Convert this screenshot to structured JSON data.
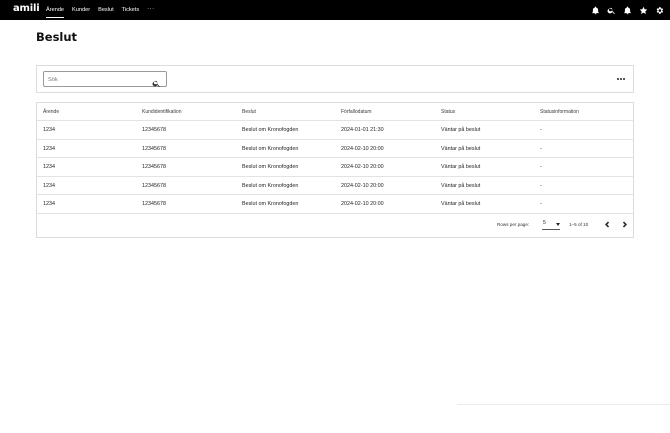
{
  "app": {
    "logo": "amili"
  },
  "nav": {
    "items": [
      {
        "label": "Ärende"
      },
      {
        "label": "Kunder"
      },
      {
        "label": "Beslut"
      },
      {
        "label": "Tickets"
      }
    ],
    "more_label": "···"
  },
  "top_icons": [
    "bell-icon",
    "search-icon",
    "notification-icon",
    "star-icon",
    "gear-icon"
  ],
  "page": {
    "title": "Beslut"
  },
  "search": {
    "placeholder": "Sök",
    "value": ""
  },
  "table": {
    "columns": [
      "Ärende",
      "Kundidentifikation",
      "Beslut",
      "Förfallodatum",
      "Status",
      "Statusinformation"
    ],
    "rows": [
      [
        "1234",
        "12345678",
        "Beslut om Kronofogden",
        "2024-01-01 21:30",
        "Väntar på beslut",
        "-"
      ],
      [
        "1234",
        "12345678",
        "Beslut om Kronofogden",
        "2024-02-10 20:00",
        "Väntar på beslut",
        "-"
      ],
      [
        "1234",
        "12345678",
        "Beslut om Kronofogden",
        "2024-02-10 20:00",
        "Väntar på beslut",
        "-"
      ],
      [
        "1234",
        "12345678",
        "Beslut om Kronofogden",
        "2024-02-10 20:00",
        "Väntar på beslut",
        "-"
      ],
      [
        "1234",
        "12345678",
        "Beslut om Kronofogden",
        "2024-02-10 20:00",
        "Väntar på beslut",
        "-"
      ]
    ]
  },
  "pagination": {
    "rows_per_page_label": "Rows per page:",
    "rows_per_page_value": "5",
    "range": "1–5 of 10"
  }
}
